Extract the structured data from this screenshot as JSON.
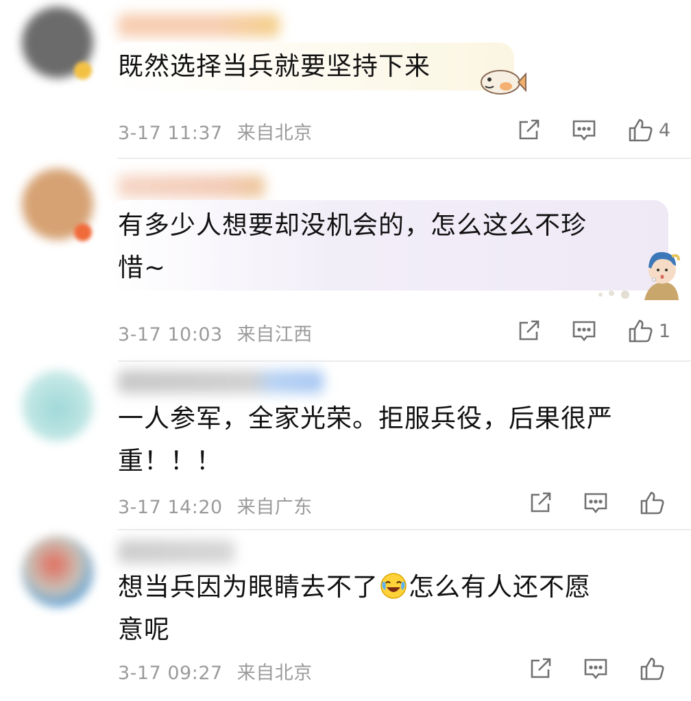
{
  "comments": [
    {
      "content": "既然选择当兵就要坚持下来",
      "date": "3-17 11:37",
      "location": "来自北京",
      "likes": "4",
      "colors": {
        "avatar": "#6b6b6b",
        "badge": "#f3c142",
        "bubble": "#fbf7e8"
      }
    },
    {
      "content": "有多少人想要却没机会的，怎么这么不珍\n惜~",
      "date": "3-17 10:03",
      "location": "来自江西",
      "likes": "1",
      "colors": {
        "avatar": "#d6a273",
        "badge": "#f06a3a",
        "bubble": "#f3eff9"
      }
    },
    {
      "content": "一人参军，全家光荣。拒服兵役，后果很严\n重！！！",
      "date": "3-17 14:20",
      "location": "来自广东",
      "likes": "",
      "colors": {
        "avatar": "#a7dedd"
      }
    },
    {
      "content_before": "想当兵因为眼睛去不了",
      "content_after": "怎么有人还不愿\n意呢",
      "date": "3-17 09:27",
      "location": "来自北京",
      "likes": "",
      "colors": {
        "avatar": "#5aa0d8"
      }
    }
  ],
  "icons": {
    "repost": "repost-icon",
    "comment": "comment-icon",
    "like": "thumbs-up-icon",
    "emoji": "laughing-crying-emoji"
  },
  "theme": {
    "meta_text": "#9a9a9a",
    "icon_stroke": "#707070",
    "divider": "#ececec"
  }
}
